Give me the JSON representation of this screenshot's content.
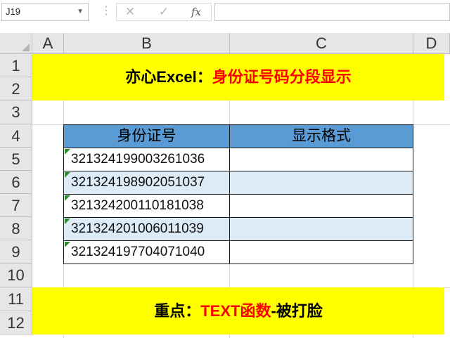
{
  "formula_bar": {
    "name_box": "J19",
    "cancel_icon": "✕",
    "enter_icon": "✓",
    "function_label": "fx",
    "formula": ""
  },
  "columns": [
    "A",
    "B",
    "C",
    "D"
  ],
  "rows": [
    "1",
    "2",
    "3",
    "4",
    "5",
    "6",
    "7",
    "8",
    "9",
    "10",
    "11",
    "12"
  ],
  "title_banner": {
    "prefix": "亦心Excel：",
    "highlight": "身份证号码分段显示"
  },
  "table": {
    "headers": [
      "身份证号",
      "显示格式"
    ],
    "rows": [
      {
        "id": "321324199003261036",
        "display": ""
      },
      {
        "id": "321324198902051037",
        "display": ""
      },
      {
        "id": "321324200110181038",
        "display": ""
      },
      {
        "id": "321324201006011039",
        "display": ""
      },
      {
        "id": "321324197704071040",
        "display": ""
      }
    ]
  },
  "footer_banner": {
    "prefix": "重点：",
    "highlight": "TEXT函数",
    "suffix": "-被打脸"
  },
  "colors": {
    "banner": "#ffff00",
    "header_fill": "#5b9bd5",
    "band_fill": "#ddebf7",
    "accent": "#ff0000"
  }
}
